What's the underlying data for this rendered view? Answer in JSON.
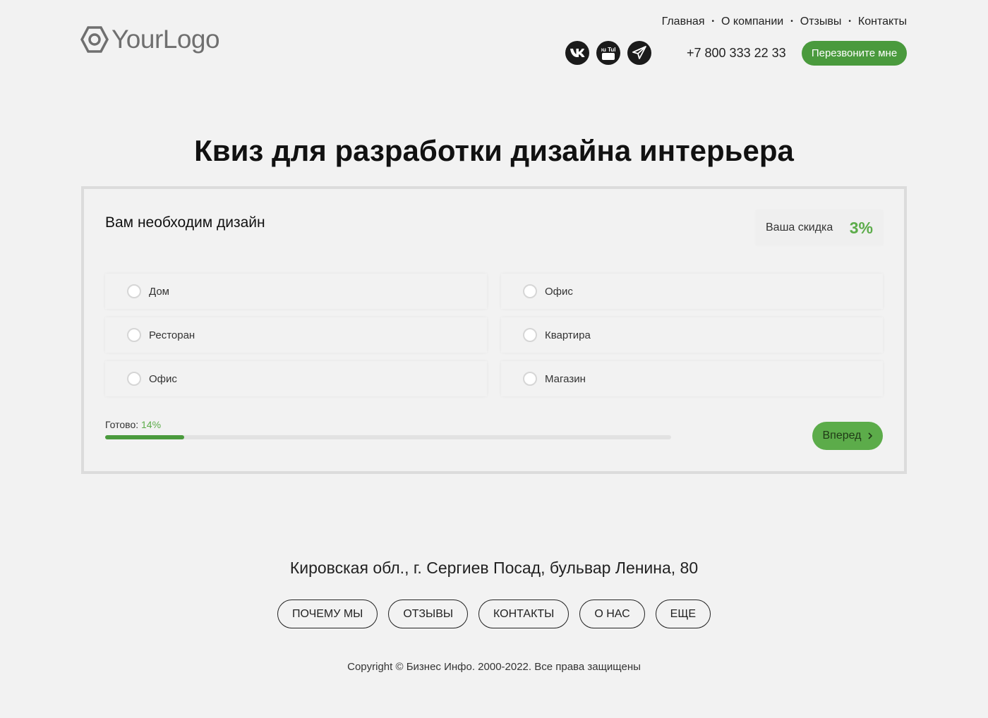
{
  "header": {
    "logo_text": "YourLogo",
    "nav": [
      "Главная",
      "О компании",
      "Отзывы",
      "Контакты"
    ],
    "nav_separator": "•",
    "socials": [
      {
        "name": "vk-icon"
      },
      {
        "name": "youtube-icon",
        "text": "You Tube"
      },
      {
        "name": "telegram-icon"
      }
    ],
    "phone": "+7 800 333 22 33",
    "callback_label": "Перезвоните мне"
  },
  "page_title": "Квиз для разработки дизайна интерьера",
  "quiz": {
    "question": "Вам необходим дизайн",
    "discount_label": "Ваша скидка",
    "discount_value": "3%",
    "options": [
      {
        "label": "Дом"
      },
      {
        "label": "Офис"
      },
      {
        "label": "Ресторан"
      },
      {
        "label": "Квартира"
      },
      {
        "label": "Офис"
      },
      {
        "label": "Магазин"
      }
    ],
    "progress_label": "Готово:",
    "progress_value": "14%",
    "progress_fraction": 0.14,
    "next_label": "Вперед"
  },
  "footer": {
    "address": "Кировская обл., г. Сергиев Посад, бульвар Ленина, 80",
    "links": [
      "ПОЧЕМУ МЫ",
      "ОТЗЫВЫ",
      "КОНТАКТЫ",
      "О НАС",
      "ЕЩЕ"
    ],
    "copyright": "Copyright © Бизнес Инфо. 2000-2022. Все права защищены"
  },
  "colors": {
    "accent": "#4a9a3d",
    "accent_light": "#5cac4a",
    "background": "#f2f2f2"
  }
}
